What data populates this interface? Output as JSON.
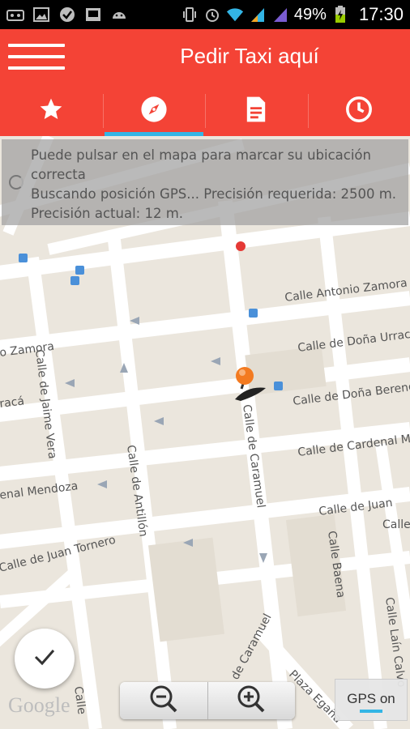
{
  "status_bar": {
    "icons": [
      "usb-icon",
      "image-icon",
      "check-circle-icon",
      "photo-icon",
      "android-icon",
      "vibrate-icon",
      "alarm-icon",
      "wifi-icon",
      "signal-icon",
      "signal-icon-2",
      "battery-charging-icon"
    ],
    "battery_percent": "49%",
    "time": "17:30"
  },
  "app_bar": {
    "title": "Pedir Taxi aquí",
    "menu_icon": "hamburger-icon"
  },
  "tabs": [
    {
      "icon": "star-icon",
      "active": false
    },
    {
      "icon": "compass-icon",
      "active": true
    },
    {
      "icon": "document-icon",
      "active": false
    },
    {
      "icon": "clock-icon",
      "active": false
    }
  ],
  "overlay": {
    "message_line1": "Puede pulsar en el mapa para marcar su ubicación correcta",
    "message_line2": "Buscando posición GPS... Precisión requerida: 2500 m. Precisión actual: 12 m."
  },
  "map": {
    "streets": [
      "Calle Antonio Zamora",
      "Calle de Doña Urraca",
      "o Zamora",
      "Calle de Doña Berenguela",
      "racá",
      "Calle de Jaime Vera",
      "Calle de Caramuel",
      "Calle de Cardenal M",
      "Calle de Antillón",
      "enal Mendoza",
      "Calle de Juan",
      "Calle de Juan Tornero",
      "Calle Baena",
      "de Caramuel",
      "Calle Laín Calvo",
      "Plaza Egaña",
      "Calle",
      "Calle"
    ],
    "google_logo": "Google"
  },
  "controls": {
    "confirm_icon": "check-icon",
    "zoom_out_icon": "zoom-out-icon",
    "zoom_in_icon": "zoom-in-icon",
    "gps_label": "GPS on"
  },
  "colors": {
    "primary": "#f44336",
    "accent": "#33b5e5",
    "map_bg": "#ebe6dd"
  }
}
